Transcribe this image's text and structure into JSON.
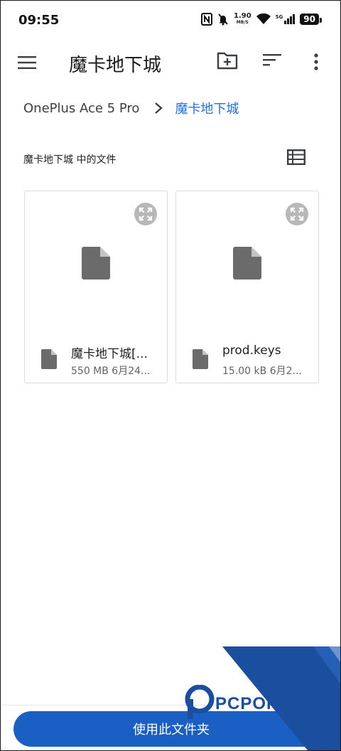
{
  "status_bar": {
    "time": "09:55",
    "net_speed_value": "1.90",
    "net_speed_unit": "MB/S",
    "network_type": "5G",
    "battery": "90"
  },
  "app_bar": {
    "title": "魔卡地下城",
    "icons": [
      "menu-icon",
      "create-folder-icon",
      "sort-icon",
      "more-vert-icon"
    ]
  },
  "breadcrumb": {
    "root": "OnePlus Ace 5 Pro",
    "current": "魔卡地下城"
  },
  "section": {
    "title": "魔卡地下城 中的文件"
  },
  "files": [
    {
      "name": "魔卡地下城[...",
      "meta": "550 MB 6月24..."
    },
    {
      "name": "prod.keys",
      "meta": "15.00 kB 6月2..."
    }
  ],
  "bottom": {
    "use_folder_label": "使用此文件夹"
  },
  "watermark": {
    "text": "PCPOP下载"
  },
  "colors": {
    "accent": "#1a73e8",
    "button": "#1a5fc4",
    "icon_grey": "#6b6b6b",
    "watermark_blue": "#1a4fa0"
  }
}
